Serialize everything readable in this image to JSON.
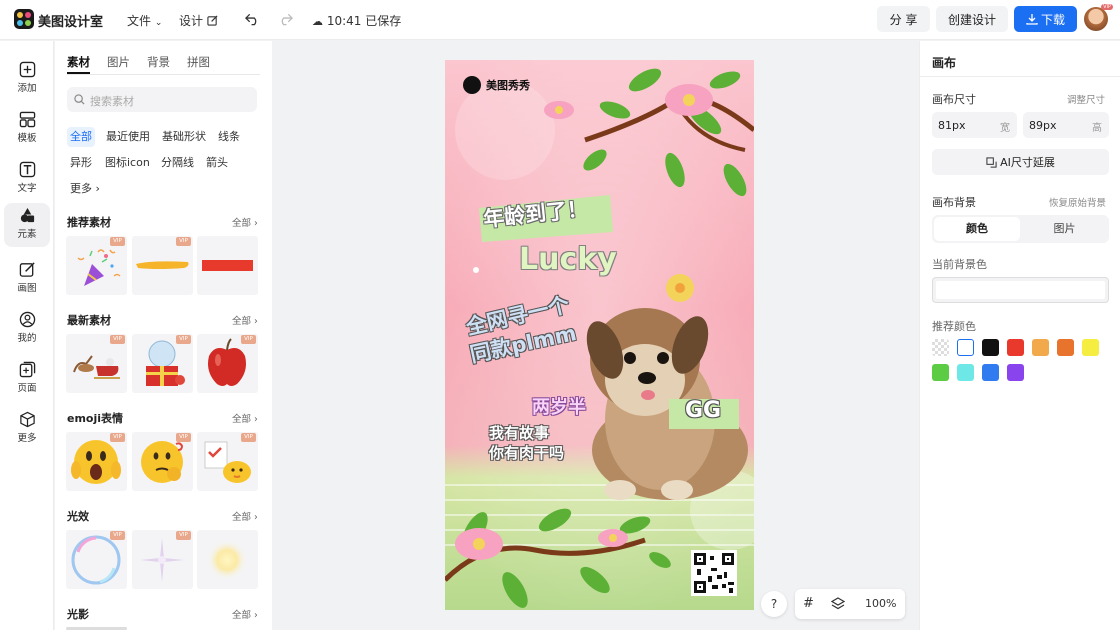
{
  "topbar": {
    "app_name": "美图设计室",
    "file_menu": "文件",
    "design_menu": "设计",
    "save_status": "10:41 已保存",
    "share": "分 享",
    "create": "创建设计",
    "download": "下载",
    "avatar_badge": "VIP"
  },
  "leftnav": {
    "items": [
      {
        "label": "添加",
        "icon": "plus-square-icon"
      },
      {
        "label": "模板",
        "icon": "template-icon"
      },
      {
        "label": "文字",
        "icon": "text-icon"
      },
      {
        "label": "元素",
        "icon": "shapes-icon"
      },
      {
        "label": "画图",
        "icon": "draw-icon"
      },
      {
        "label": "我的",
        "icon": "user-icon"
      },
      {
        "label": "页面",
        "icon": "page-icon"
      },
      {
        "label": "更多",
        "icon": "cube-icon"
      }
    ]
  },
  "panel": {
    "tabs": [
      "素材",
      "图片",
      "背景",
      "拼图"
    ],
    "search_placeholder": "搜索素材",
    "chips": [
      "全部",
      "最近使用",
      "基础形状",
      "线条",
      "异形",
      "图标icon",
      "分隔线",
      "箭头",
      "更多"
    ],
    "vip_label": "VIP",
    "all_label": "全部",
    "sections": [
      {
        "title": "推荐素材"
      },
      {
        "title": "最新素材"
      },
      {
        "title": "emoji表情"
      },
      {
        "title": "光效"
      },
      {
        "title": "光影"
      }
    ]
  },
  "poster": {
    "brand": "美图秀秀",
    "headline": "年龄到了！",
    "lucky": "Lucky",
    "line1": "全网寻一个",
    "line2": "同款plmm",
    "age": "两岁半",
    "gg": "GG",
    "story1": "我有故事",
    "story2": "你有肉干吗"
  },
  "canvas_controls": {
    "help": "?",
    "zoom": "100%"
  },
  "rpanel": {
    "title": "画布",
    "size_label": "画布尺寸",
    "resize_link": "调整尺寸",
    "width_value": "81px",
    "width_unit": "宽",
    "height_value": "89px",
    "height_unit": "高",
    "ai_expand": "AI尺寸延展",
    "bg_label": "画布背景",
    "restore_bg": "恢复原始背景",
    "tab_color": "颜色",
    "tab_image": "图片",
    "current_bg": "当前背景色",
    "recommended": "推荐颜色",
    "swatches": [
      "transparent",
      "#ffffff",
      "#111111",
      "#e8392c",
      "#f2a94c",
      "#e8732c",
      "#f5ee41",
      "#5dcc45",
      "#6ee8e6",
      "#2f7bef",
      "#8a44ee"
    ]
  }
}
